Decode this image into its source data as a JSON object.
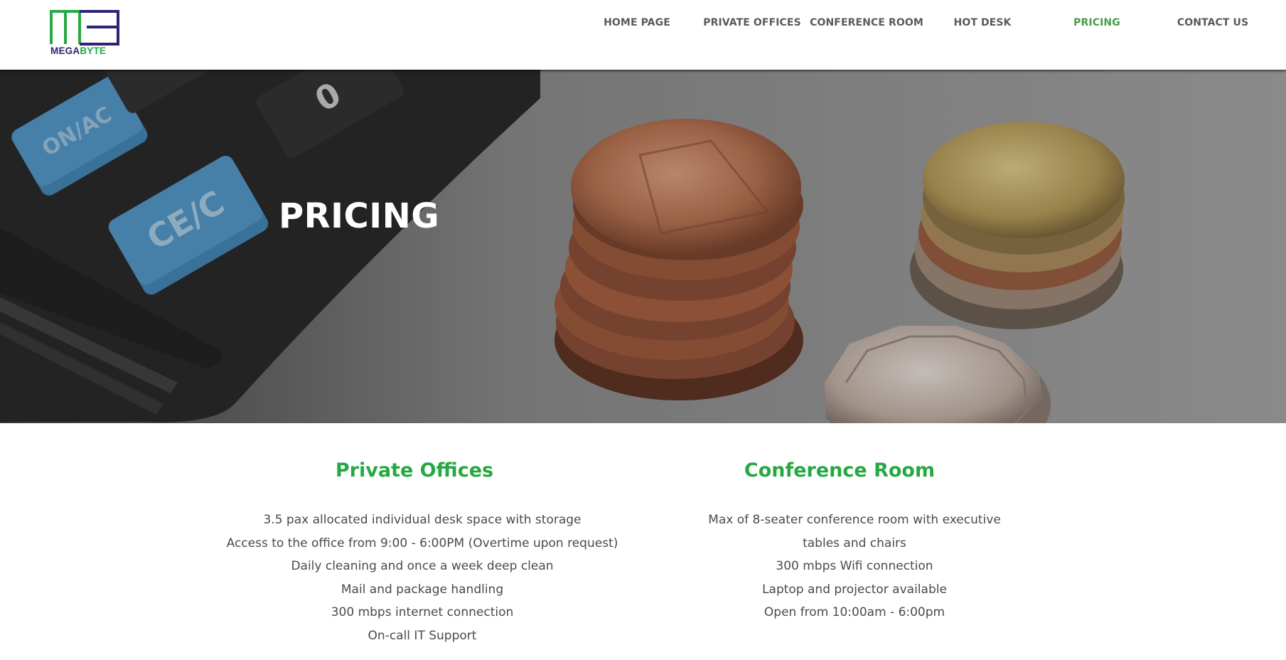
{
  "brand": {
    "name_part1": "MEGA",
    "name_part2": "BYTE",
    "colors": {
      "navy": "#2d2377",
      "green": "#27a844"
    }
  },
  "nav": {
    "items": [
      {
        "label": "HOME PAGE",
        "active": false
      },
      {
        "label": "PRIVATE OFFICES",
        "active": false
      },
      {
        "label": "CONFERENCE ROOM",
        "active": false
      },
      {
        "label": "HOT DESK",
        "active": false
      },
      {
        "label": "PRICING",
        "active": true
      },
      {
        "label": "CONTACT US",
        "active": false
      }
    ],
    "active_color": "#4a9a4a"
  },
  "hero": {
    "title": "PRICING",
    "calculator_keys": [
      "ON/AC",
      "CE/C",
      "0"
    ]
  },
  "sections": {
    "private_offices": {
      "title": "Private Offices",
      "items": [
        "3.5 pax allocated individual desk space with storage",
        "Access to the office from 9:00 - 6:00PM (Overtime upon request)",
        "Daily cleaning and once a week deep clean",
        "Mail and package handling",
        "300 mbps internet connection",
        "On-call IT Support"
      ]
    },
    "conference_room": {
      "title": "Conference Room",
      "items": [
        "Max of 8-seater conference room with executive tables and chairs",
        "300 mbps Wifi connection",
        "Laptop and projector available",
        "Open from 10:00am - 6:00pm"
      ]
    }
  }
}
